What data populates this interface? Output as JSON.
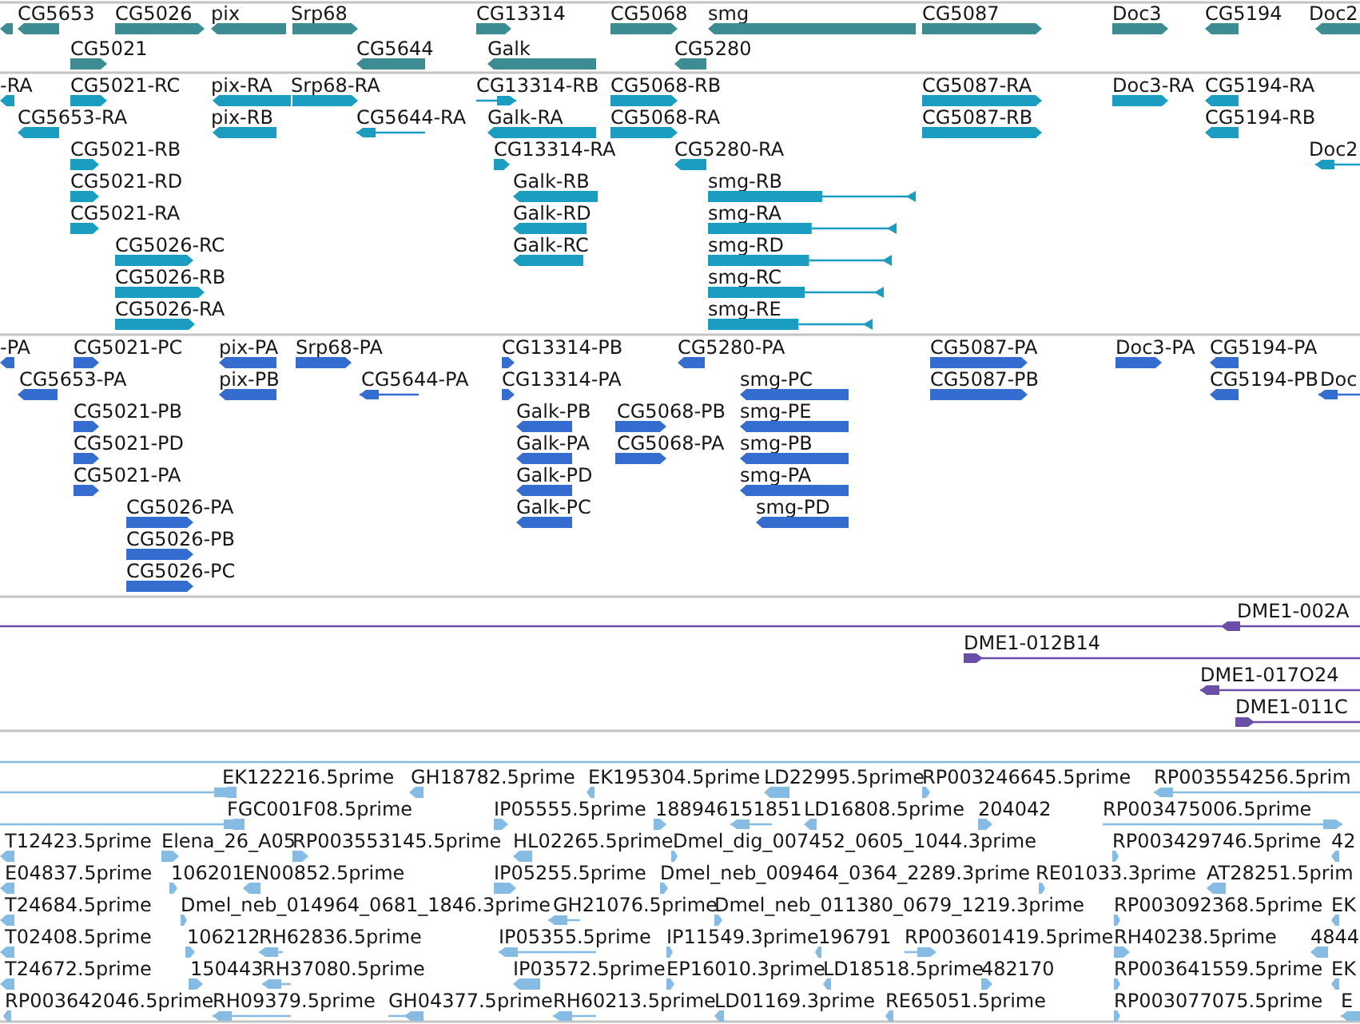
{
  "tracks": [
    {
      "color": "#3d8c93",
      "features": [
        {
          "reverse": true
        },
        {
          "label": "CG5653",
          "reverse": true
        },
        {
          "label": "CG5026",
          "reverse": false
        },
        {
          "label": "pix",
          "reverse": true
        },
        {
          "label": "Srp68",
          "reverse": false
        },
        {
          "label": "CG13314",
          "reverse": false
        },
        {
          "label": "CG5068",
          "reverse": false
        },
        {
          "label": "smg",
          "reverse": true
        },
        {
          "label": "CG5087",
          "reverse": false
        },
        {
          "label": "Doc3",
          "reverse": false
        },
        {
          "label": "CG5194",
          "reverse": true
        },
        {
          "label": "Doc2",
          "reverse": true
        },
        {
          "label": "CG5021",
          "reverse": false
        },
        {
          "label": "CG5644",
          "reverse": true
        },
        {
          "label": "Galk",
          "reverse": true
        },
        {
          "label": "CG5280",
          "reverse": true
        }
      ]
    },
    {
      "color": "#1b9cc1",
      "features": [
        {
          "label": "-RA",
          "reverse": true
        },
        {
          "label": "CG5021-RC",
          "reverse": false
        },
        {
          "label": "pix-RA",
          "reverse": true
        },
        {
          "label": "Srp68-RA",
          "reverse": false
        },
        {
          "label": "CG13314-RB",
          "reverse": false
        },
        {
          "label": "CG5068-RB",
          "reverse": false
        },
        {
          "label": "CG5087-RA",
          "reverse": false
        },
        {
          "label": "Doc3-RA",
          "reverse": false
        },
        {
          "label": "CG5194-RA",
          "reverse": true
        },
        {
          "label": "CG5653-RA",
          "reverse": true
        },
        {
          "label": "pix-RB",
          "reverse": true
        },
        {
          "label": "CG5644-RA",
          "reverse": true
        },
        {
          "label": "Galk-RA",
          "reverse": true
        },
        {
          "label": "CG5068-RA",
          "reverse": false
        },
        {
          "label": "CG5087-RB",
          "reverse": false
        },
        {
          "label": "CG5194-RB",
          "reverse": true
        },
        {
          "label": "CG5021-RB",
          "reverse": false
        },
        {
          "label": "CG13314-RA",
          "reverse": false
        },
        {
          "label": "CG5280-RA",
          "reverse": true
        },
        {
          "label": "Doc2",
          "reverse": true
        },
        {
          "label": "CG5021-RD",
          "reverse": false
        },
        {
          "label": "Galk-RB",
          "reverse": true
        },
        {
          "label": "smg-RB",
          "reverse": true
        },
        {
          "label": "CG5021-RA",
          "reverse": false
        },
        {
          "label": "Galk-RD",
          "reverse": true
        },
        {
          "label": "smg-RA",
          "reverse": true
        },
        {
          "label": "CG5026-RC",
          "reverse": false
        },
        {
          "label": "Galk-RC",
          "reverse": true
        },
        {
          "label": "smg-RD",
          "reverse": true
        },
        {
          "label": "CG5026-RB",
          "reverse": false
        },
        {
          "label": "smg-RC",
          "reverse": true
        },
        {
          "label": "CG5026-RA",
          "reverse": false
        },
        {
          "label": "smg-RE",
          "reverse": true
        }
      ]
    },
    {
      "color": "#346ccf",
      "features": [
        {
          "label": "-PA",
          "reverse": true
        },
        {
          "label": "CG5021-PC",
          "reverse": false
        },
        {
          "label": "pix-PA",
          "reverse": true
        },
        {
          "label": "Srp68-PA",
          "reverse": false
        },
        {
          "label": "CG13314-PB",
          "reverse": false
        },
        {
          "label": "CG5280-PA",
          "reverse": true
        },
        {
          "label": "CG5087-PA",
          "reverse": false
        },
        {
          "label": "Doc3-PA",
          "reverse": false
        },
        {
          "label": "CG5194-PA",
          "reverse": true
        },
        {
          "label": "CG5653-PA",
          "reverse": true
        },
        {
          "label": "pix-PB",
          "reverse": true
        },
        {
          "label": "CG5644-PA",
          "reverse": true
        },
        {
          "label": "CG13314-PA",
          "reverse": false
        },
        {
          "label": "smg-PC",
          "reverse": true
        },
        {
          "label": "CG5087-PB",
          "reverse": false
        },
        {
          "label": "CG5194-PB",
          "reverse": true
        },
        {
          "label": "Doc",
          "reverse": true
        },
        {
          "label": "CG5021-PB",
          "reverse": false
        },
        {
          "label": "Galk-PB",
          "reverse": true
        },
        {
          "label": "CG5068-PB",
          "reverse": false
        },
        {
          "label": "smg-PE",
          "reverse": true
        },
        {
          "label": "CG5021-PD",
          "reverse": false
        },
        {
          "label": "Galk-PA",
          "reverse": true
        },
        {
          "label": "CG5068-PA",
          "reverse": false
        },
        {
          "label": "smg-PB",
          "reverse": true
        },
        {
          "label": "CG5021-PA",
          "reverse": false
        },
        {
          "label": "Galk-PD",
          "reverse": true
        },
        {
          "label": "smg-PA",
          "reverse": true
        },
        {
          "label": "CG5026-PA",
          "reverse": false
        },
        {
          "label": "Galk-PC",
          "reverse": true
        },
        {
          "label": "smg-PD",
          "reverse": true
        },
        {
          "label": "CG5026-PB",
          "reverse": false
        },
        {
          "label": "CG5026-PC",
          "reverse": false
        }
      ]
    },
    {
      "color": "#6a4ea8",
      "features": [
        {
          "label": "DME1-002A",
          "reverse": true
        },
        {
          "label": "DME1-012B14",
          "reverse": false
        },
        {
          "label": "DME1-017O24",
          "reverse": true
        },
        {
          "label": "DME1-011C",
          "reverse": false
        }
      ]
    },
    {
      "color": "#86bce3",
      "features": [
        {
          "reverse": false
        },
        {
          "label": "EK122216.5prime",
          "reverse": true
        },
        {
          "label": "GH18782.5prime",
          "reverse": true
        },
        {
          "label": "EK195304.5prime",
          "reverse": true
        },
        {
          "label": "LD22995.5prime",
          "reverse": true
        },
        {
          "label": "RP003246645.5prime",
          "reverse": false
        },
        {
          "label": "RP003554256.5prim",
          "reverse": true
        },
        {
          "reverse": false
        },
        {
          "label": "FGC001F08.5prime",
          "reverse": true
        },
        {
          "label": "IP05555.5prime",
          "reverse": false
        },
        {
          "label": "188946",
          "reverse": false
        },
        {
          "label": "151851",
          "reverse": true
        },
        {
          "label": "LD16808.5prime",
          "reverse": true
        },
        {
          "label": "204042",
          "reverse": false
        },
        {
          "label": "RP003475006.5prime",
          "reverse": false
        },
        {
          "label": "T12423.5prime",
          "reverse": true
        },
        {
          "label": "Elena_26_A05",
          "reverse": false
        },
        {
          "label": "RP003553145.5prime",
          "reverse": false
        },
        {
          "label": "HL02265.5prime",
          "reverse": true
        },
        {
          "label": "Dmel_dig_007452_0605_1044.3prime",
          "reverse": false
        },
        {
          "label": "RP003429746.5prime",
          "reverse": false
        },
        {
          "label": "42",
          "reverse": true
        },
        {
          "label": "E04837.5prime",
          "reverse": true
        },
        {
          "label": "106201",
          "reverse": false
        },
        {
          "label": "EN00852.5prime",
          "reverse": true
        },
        {
          "label": "IP05255.5prime",
          "reverse": false
        },
        {
          "label": "Dmel_neb_009464_0364_2289.3prime",
          "reverse": false
        },
        {
          "label": "RE01033.3prime",
          "reverse": false
        },
        {
          "label": "AT28251.5prim",
          "reverse": true
        },
        {
          "label": "T24684.5prime",
          "reverse": true
        },
        {
          "label": "Dmel_neb_014964_0681_1846.3prime",
          "reverse": false
        },
        {
          "label": "GH21076.5prime",
          "reverse": true
        },
        {
          "label": "Dmel_neb_011380_0679_1219.3prime",
          "reverse": false
        },
        {
          "label": "RP003092368.5prime",
          "reverse": false
        },
        {
          "label": "EK",
          "reverse": true
        },
        {
          "label": "T02408.5prime",
          "reverse": true
        },
        {
          "label": "106212",
          "reverse": false
        },
        {
          "label": "RH62836.5prime",
          "reverse": true
        },
        {
          "label": "IP05355.5prime",
          "reverse": true
        },
        {
          "label": "IP11549.3prime",
          "reverse": false
        },
        {
          "label": "196791",
          "reverse": true
        },
        {
          "label": "RP003601419.5prime",
          "reverse": false
        },
        {
          "label": "RH40238.5prime",
          "reverse": false
        },
        {
          "label": "4844",
          "reverse": true
        },
        {
          "label": "T24672.5prime",
          "reverse": true
        },
        {
          "label": "150443",
          "reverse": false
        },
        {
          "label": "RH37080.5prime",
          "reverse": true
        },
        {
          "label": "IP03572.5prime",
          "reverse": true
        },
        {
          "label": "EP16010.3prime",
          "reverse": false
        },
        {
          "label": "LD18518.5prime",
          "reverse": true
        },
        {
          "label": "482170",
          "reverse": false
        },
        {
          "label": "RP003641559.5prime",
          "reverse": false
        },
        {
          "label": "EK",
          "reverse": true
        },
        {
          "label": "RP003642046.5prime",
          "reverse": true
        },
        {
          "label": "RH09379.5prime",
          "reverse": true
        },
        {
          "label": "GH04377.5prime",
          "reverse": true
        },
        {
          "label": "RH60213.5prime",
          "reverse": true
        },
        {
          "label": "LD01169.3prime",
          "reverse": true
        },
        {
          "label": "RE65051.5prime",
          "reverse": true
        },
        {
          "label": "RP003077075.5prime",
          "reverse": false
        },
        {
          "label": "E",
          "reverse": true
        }
      ]
    }
  ]
}
